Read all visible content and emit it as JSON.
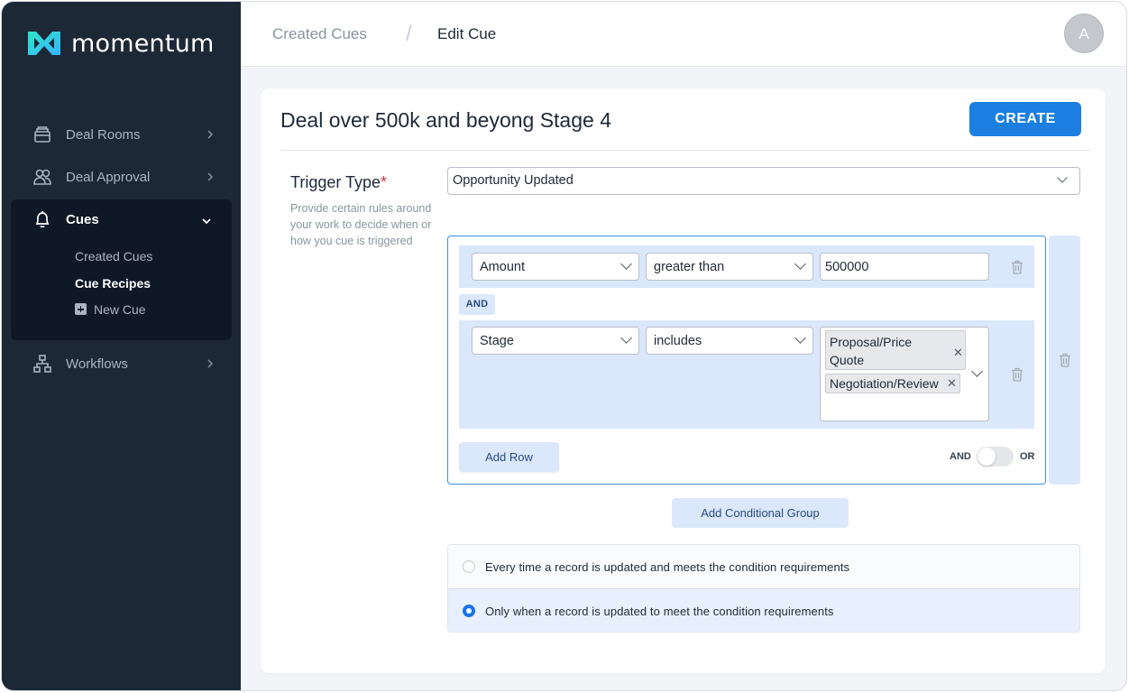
{
  "app": {
    "name": "momentum"
  },
  "sidebar": {
    "items": [
      {
        "label": "Deal Rooms",
        "icon": "archive-box-icon"
      },
      {
        "label": "Deal Approval",
        "icon": "users-icon"
      },
      {
        "label": "Cues",
        "icon": "bell-icon",
        "expanded": true,
        "children": [
          {
            "label": "Created Cues",
            "active": false
          },
          {
            "label": "Cue Recipes",
            "active": true
          },
          {
            "label": "New Cue",
            "icon": "plus-square-icon",
            "active": false
          }
        ]
      },
      {
        "label": "Workflows",
        "icon": "sitemap-icon"
      }
    ]
  },
  "header": {
    "breadcrumbs": [
      "Created Cues",
      "Edit Cue"
    ],
    "separator": "/",
    "avatar_initial": "A"
  },
  "cue": {
    "title": "Deal over 500k and beyong Stage 4",
    "create_label": "CREATE",
    "trigger": {
      "label": "Trigger Type",
      "required_mark": "*",
      "help": "Provide certain rules around your work to decide when or how you cue is triggered",
      "value": "Opportunity Updated"
    },
    "conditions": {
      "rows": [
        {
          "field": "Amount",
          "operator": "greater than",
          "value": "500000"
        },
        {
          "field": "Stage",
          "operator": "includes",
          "values": [
            "Proposal/Price Quote",
            "Negotiation/Review"
          ]
        }
      ],
      "join_label": "AND",
      "add_row_label": "Add Row",
      "toggle": {
        "left": "AND",
        "right": "OR",
        "selected": "AND"
      }
    },
    "add_group_label": "Add Conditional Group",
    "frequency": {
      "options": [
        "Every time a record is updated and meets the condition requirements",
        "Only when a record is updated to meet the condition requirements"
      ],
      "selected_index": 1
    }
  },
  "colors": {
    "sidebar_bg": "#1d2837",
    "sidebar_active_bg": "#0f1827",
    "accent": "#1a7fe0",
    "condition_bg": "#dbe8fb",
    "logo_gradient": [
      "#2de6c6",
      "#37b2ff"
    ]
  }
}
